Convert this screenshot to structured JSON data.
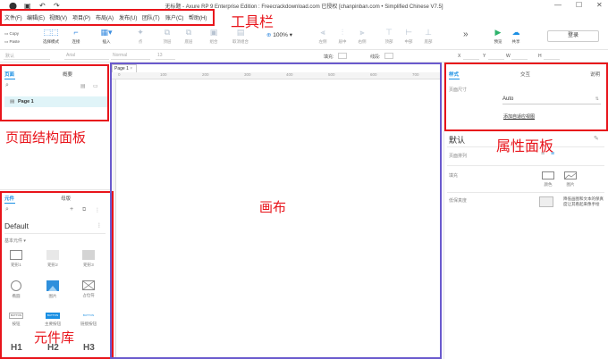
{
  "window": {
    "title": "无标题 - Axure RP 9 Enterprise Edition : Freecrackdownload.com 已授权    [chanpinban.com • Simplified Chinese V7.5]",
    "controls": [
      "—",
      "☐",
      "✕"
    ]
  },
  "menu": [
    "文件(F)",
    "编辑(E)",
    "视图(V)",
    "项目(P)",
    "布局(A)",
    "发布(U)",
    "团队(T)",
    "账户(C)",
    "帮助(H)"
  ],
  "toolbar": {
    "copy": "Copy",
    "paste": "Paste",
    "select_mode": "选择模式",
    "connect": "连接",
    "insert": "插入",
    "point": "点",
    "top": "顶层",
    "bottom": "底层",
    "group": "组合",
    "ungroup": "取消组合",
    "zoom": "100%",
    "left": "左侧",
    "center": "居中",
    "right": "右侧",
    "top2": "顶部",
    "middle": "中部",
    "bottom2": "底部",
    "more": "»",
    "preview": "预览",
    "share": "共享",
    "login": "登录"
  },
  "format": {
    "style": "默认",
    "font": "Arial",
    "weight": "Normal",
    "size": "13",
    "fill_label": "填充:",
    "line_label": "线段:",
    "x": "X",
    "y": "Y",
    "w": "W",
    "h": "H"
  },
  "pages_panel": {
    "tabs": [
      "页面",
      "概要"
    ],
    "pages": [
      "Page 1"
    ]
  },
  "library_panel": {
    "tabs": [
      "元件",
      "母版"
    ],
    "library": "Default",
    "category": "基本元件 ▾",
    "widgets": [
      {
        "label": "矩形1"
      },
      {
        "label": "矩形2"
      },
      {
        "label": "矩形3"
      },
      {
        "label": "椭圆"
      },
      {
        "label": "图片"
      },
      {
        "label": "占位符"
      },
      {
        "label": "按钮"
      },
      {
        "label": "主要按钮"
      },
      {
        "label": "链接按钮"
      },
      {
        "label": "H1"
      },
      {
        "label": "H2"
      },
      {
        "label": "H3"
      }
    ],
    "button_text": "BUTTON"
  },
  "canvas": {
    "tab": "Page 1",
    "ruler": [
      "0",
      "100",
      "200",
      "300",
      "400",
      "500",
      "600",
      "700"
    ]
  },
  "right_panel": {
    "tabs": [
      "样式",
      "交互",
      "说明"
    ],
    "page_size_label": "页面尺寸",
    "page_size_value": "Auto",
    "adaptive_link": "添加自适应视图",
    "style_name": "默认",
    "page_align_label": "页面排列",
    "fill_label": "填充",
    "fill_color": "颜色",
    "fill_image": "图片",
    "low_fidelity_label": "低保真度",
    "low_fidelity_text": "降低画图和文本的保真度让其看起来像手绘"
  },
  "annotations": {
    "toolbar": "工具栏",
    "page_panel": "页面结构面板",
    "canvas": "画布",
    "properties": "属性面板",
    "library": "元件库"
  },
  "colors": {
    "annotation_red": "#e8141b",
    "canvas_border": "#6a5acd",
    "accent_blue": "#1a8fe3",
    "preview_green": "#2db36b"
  }
}
